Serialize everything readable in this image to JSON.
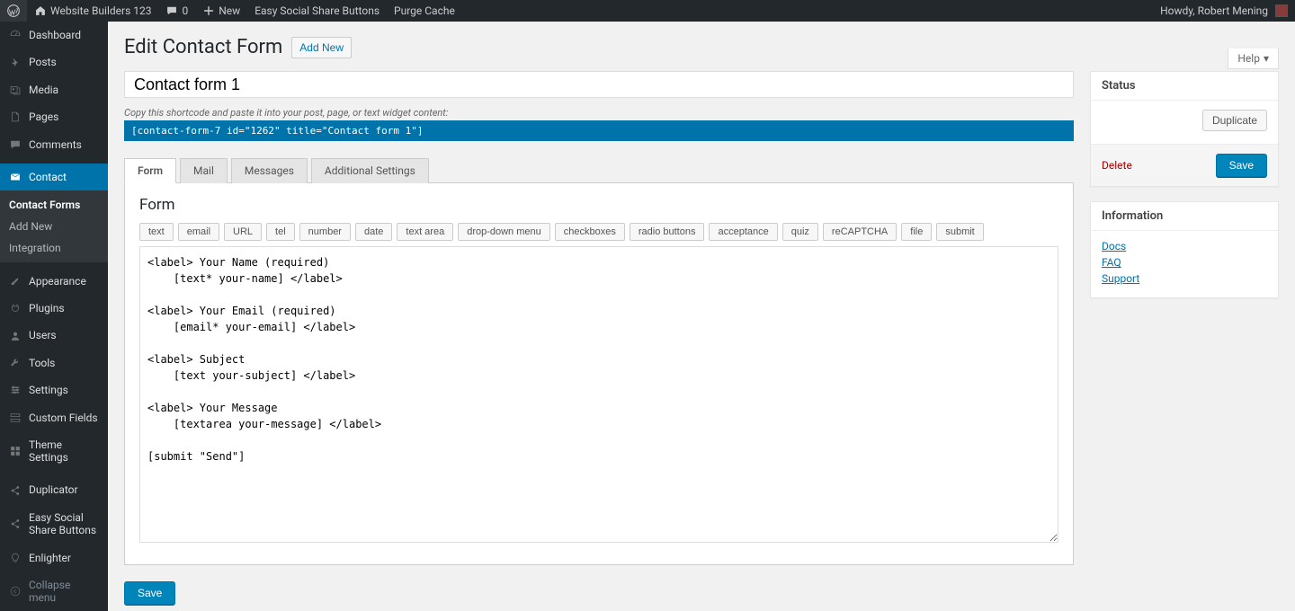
{
  "adminBar": {
    "site": "Website Builders 123",
    "comments": "0",
    "new": "New",
    "extra1": "Easy Social Share Buttons",
    "extra2": "Purge Cache",
    "howdy": "Howdy, Robert Mening"
  },
  "sidebar": {
    "items": [
      {
        "label": "Dashboard",
        "icon": "dashboard"
      },
      {
        "label": "Posts",
        "icon": "pin"
      },
      {
        "label": "Media",
        "icon": "media"
      },
      {
        "label": "Pages",
        "icon": "page"
      },
      {
        "label": "Comments",
        "icon": "comment"
      },
      {
        "label": "Contact",
        "icon": "mail",
        "current": true
      },
      {
        "label": "Appearance",
        "icon": "brush"
      },
      {
        "label": "Plugins",
        "icon": "plugin"
      },
      {
        "label": "Users",
        "icon": "user"
      },
      {
        "label": "Tools",
        "icon": "tools"
      },
      {
        "label": "Settings",
        "icon": "settings"
      },
      {
        "label": "Custom Fields",
        "icon": "fields"
      },
      {
        "label": "Theme Settings",
        "icon": "theme"
      },
      {
        "label": "Duplicator",
        "icon": "share"
      },
      {
        "label": "Easy Social Share Buttons",
        "icon": "share2"
      },
      {
        "label": "Enlighter",
        "icon": "bulb"
      }
    ],
    "submenu": [
      {
        "label": "Contact Forms",
        "current": true
      },
      {
        "label": "Add New"
      },
      {
        "label": "Integration"
      }
    ],
    "collapse": "Collapse menu"
  },
  "page": {
    "title": "Edit Contact Form",
    "addNew": "Add New",
    "help": "Help",
    "formTitle": "Contact form 1",
    "shortcodeDesc": "Copy this shortcode and paste it into your post, page, or text widget content:",
    "shortcode": "[contact-form-7 id=\"1262\" title=\"Contact form 1\"]",
    "tabs": [
      "Form",
      "Mail",
      "Messages",
      "Additional Settings"
    ],
    "panelTitle": "Form",
    "tagButtons": [
      "text",
      "email",
      "URL",
      "tel",
      "number",
      "date",
      "text area",
      "drop-down menu",
      "checkboxes",
      "radio buttons",
      "acceptance",
      "quiz",
      "reCAPTCHA",
      "file",
      "submit"
    ],
    "formBody": "<label> Your Name (required)\n    [text* your-name] </label>\n\n<label> Your Email (required)\n    [email* your-email] </label>\n\n<label> Subject\n    [text your-subject] </label>\n\n<label> Your Message\n    [textarea your-message] </label>\n\n[submit \"Send\"]",
    "save": "Save"
  },
  "meta": {
    "status": {
      "title": "Status",
      "duplicate": "Duplicate",
      "delete": "Delete",
      "save": "Save"
    },
    "info": {
      "title": "Information",
      "links": [
        "Docs",
        "FAQ",
        "Support"
      ]
    }
  }
}
